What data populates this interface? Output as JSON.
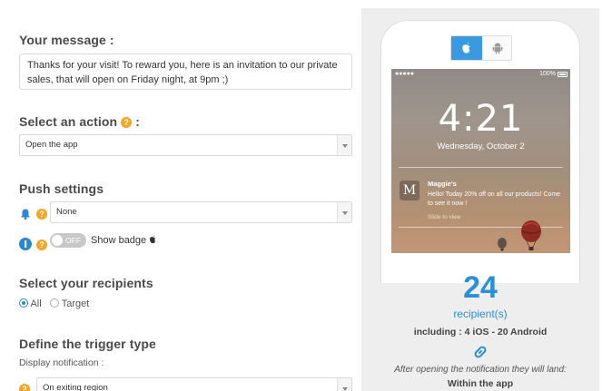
{
  "message": {
    "label": "Your message :",
    "value": "Thanks for your visit! To reward you, here is an invitation to our private sales, that will open on Friday night, at 9pm ;)"
  },
  "action": {
    "label": "Select an action",
    "colon": ":",
    "help": "?",
    "selected": "Open the app"
  },
  "push": {
    "label": "Push settings",
    "sound_selected": "None",
    "badge_toggle": "OFF",
    "badge_label": "Show badge",
    "help": "?"
  },
  "recipients": {
    "label": "Select your recipients",
    "options": [
      "All",
      "Target"
    ],
    "selected": "All"
  },
  "trigger": {
    "label": "Define the trigger type",
    "sub_label": "Display notification :",
    "selected": "On exiting region"
  },
  "preview": {
    "status_left": "●●●●●",
    "status_right": "100%",
    "time": "4:21",
    "date": "Wednesday, October 2",
    "notif_logo": "M",
    "notif_title": "Maggie's",
    "notif_body": "Hello! Today 20% off on all our products! Come to see it now !",
    "notif_slide": "Slide to view",
    "os_selected": "apple-icon"
  },
  "stats": {
    "count": "24",
    "count_label": "recipient(s)",
    "breakdown": "including : 4 iOS - 20 Android",
    "after_text": "After opening the notification they will land:",
    "landing": "Within the app"
  },
  "colors": {
    "accent": "#2a8fd6",
    "help": "#f5a623",
    "toggle_off": "#c8c8c8"
  }
}
